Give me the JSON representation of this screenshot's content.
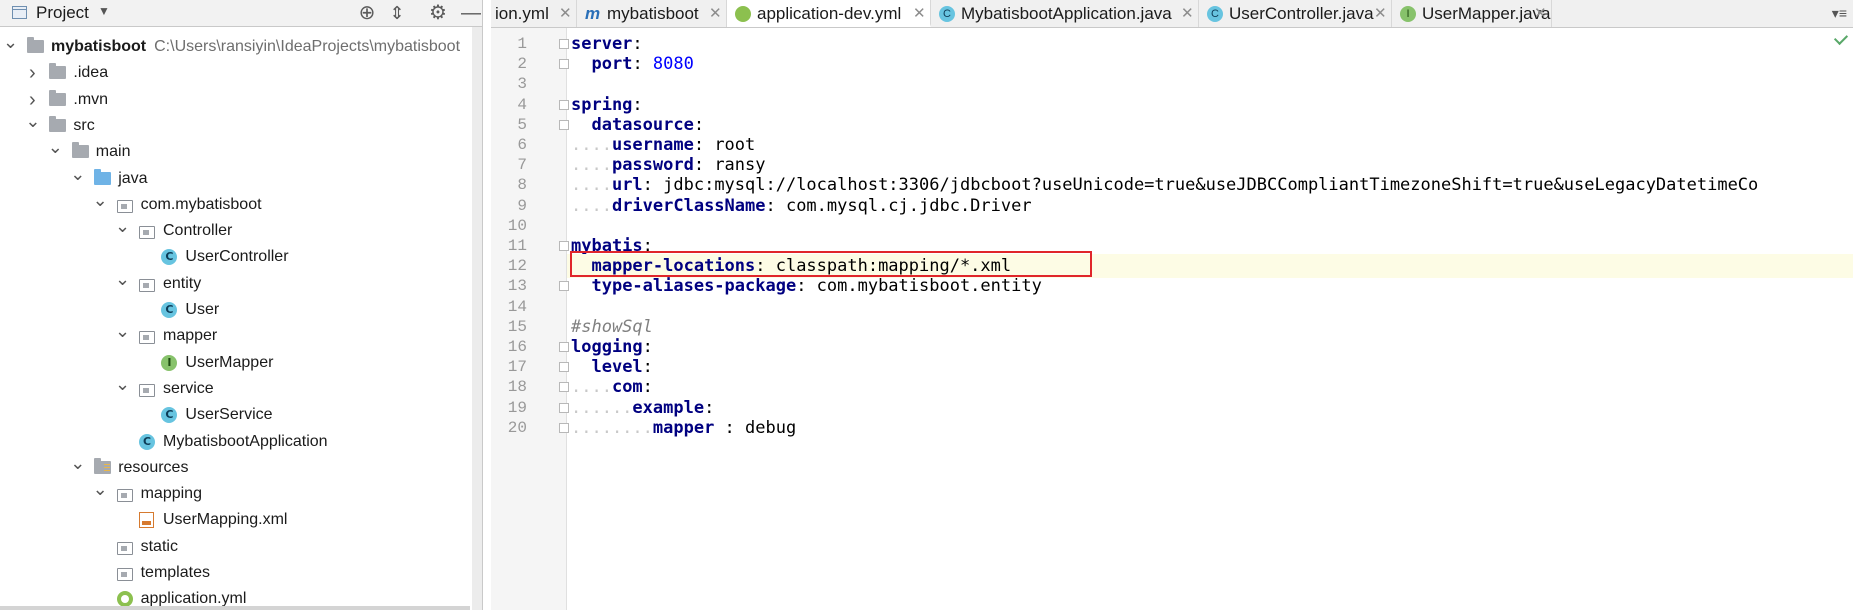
{
  "project_panel": {
    "title": "Project",
    "tree": [
      {
        "label": "mybatisboot",
        "sub": "C:\\Users\\ransiyin\\IdeaProjects\\mybatisboot",
        "depth": 0,
        "icon": "module-folder-icon",
        "expanded": true,
        "bold": true
      },
      {
        "label": ".idea",
        "depth": 1,
        "icon": "folder-icon",
        "expanded": false
      },
      {
        "label": ".mvn",
        "depth": 1,
        "icon": "folder-icon",
        "expanded": false
      },
      {
        "label": "src",
        "depth": 1,
        "icon": "folder-icon",
        "expanded": true
      },
      {
        "label": "main",
        "depth": 2,
        "icon": "folder-icon",
        "expanded": true
      },
      {
        "label": "java",
        "depth": 3,
        "icon": "source-folder-icon",
        "expanded": true
      },
      {
        "label": "com.mybatisboot",
        "depth": 4,
        "icon": "package-icon",
        "expanded": true
      },
      {
        "label": "Controller",
        "depth": 5,
        "icon": "package-icon",
        "expanded": true
      },
      {
        "label": "UserController",
        "depth": 6,
        "icon": "class-icon",
        "leaf": true
      },
      {
        "label": "entity",
        "depth": 5,
        "icon": "package-icon",
        "expanded": true
      },
      {
        "label": "User",
        "depth": 6,
        "icon": "class-icon",
        "leaf": true
      },
      {
        "label": "mapper",
        "depth": 5,
        "icon": "package-icon",
        "expanded": true
      },
      {
        "label": "UserMapper",
        "depth": 6,
        "icon": "interface-icon",
        "leaf": true
      },
      {
        "label": "service",
        "depth": 5,
        "icon": "package-icon",
        "expanded": true
      },
      {
        "label": "UserService",
        "depth": 6,
        "icon": "class-icon",
        "leaf": true
      },
      {
        "label": "MybatisbootApplication",
        "depth": 5,
        "icon": "spring-boot-class-icon",
        "leaf": true
      },
      {
        "label": "resources",
        "depth": 3,
        "icon": "resources-folder-icon",
        "expanded": true
      },
      {
        "label": "mapping",
        "depth": 4,
        "icon": "package-icon",
        "expanded": true
      },
      {
        "label": "UserMapping.xml",
        "depth": 5,
        "icon": "xml-file-icon",
        "leaf": true
      },
      {
        "label": "static",
        "depth": 4,
        "icon": "package-icon",
        "leaf": true
      },
      {
        "label": "templates",
        "depth": 4,
        "icon": "package-icon",
        "leaf": true
      },
      {
        "label": "application.yml",
        "depth": 4,
        "icon": "yml-file-icon",
        "leaf": true
      }
    ]
  },
  "tabs": [
    {
      "label": "ion.yml",
      "icon": "",
      "active": false
    },
    {
      "label": "mybatisboot",
      "icon": "m",
      "active": false
    },
    {
      "label": "application-dev.yml",
      "icon": "yml-file-icon",
      "active": true
    },
    {
      "label": "MybatisbootApplication.java",
      "icon": "spring-boot-class-icon",
      "active": false
    },
    {
      "label": "UserController.java",
      "icon": "class-icon",
      "active": false
    },
    {
      "label": "UserMapper.java",
      "icon": "interface-icon",
      "active": false
    }
  ],
  "editor": {
    "highlighted_line": 12,
    "lines": [
      {
        "n": "1",
        "tokens": [
          {
            "t": "server",
            "c": "k"
          },
          {
            "t": ":",
            "c": "v"
          }
        ]
      },
      {
        "n": "2",
        "tokens": [
          {
            "t": "  ",
            "c": "dots"
          },
          {
            "t": "port",
            "c": "k"
          },
          {
            "t": ": ",
            "c": "v"
          },
          {
            "t": "8080",
            "c": "n"
          }
        ]
      },
      {
        "n": "3",
        "tokens": []
      },
      {
        "n": "4",
        "tokens": [
          {
            "t": "spring",
            "c": "k"
          },
          {
            "t": ":",
            "c": "v"
          }
        ]
      },
      {
        "n": "5",
        "tokens": [
          {
            "t": "  ",
            "c": "dots"
          },
          {
            "t": "datasource",
            "c": "k"
          },
          {
            "t": ":",
            "c": "v"
          }
        ]
      },
      {
        "n": "6",
        "tokens": [
          {
            "t": "....",
            "c": "dots"
          },
          {
            "t": "username",
            "c": "k"
          },
          {
            "t": ": root",
            "c": "v"
          }
        ]
      },
      {
        "n": "7",
        "tokens": [
          {
            "t": "....",
            "c": "dots"
          },
          {
            "t": "password",
            "c": "k"
          },
          {
            "t": ": ransy",
            "c": "v"
          }
        ]
      },
      {
        "n": "8",
        "tokens": [
          {
            "t": "....",
            "c": "dots"
          },
          {
            "t": "url",
            "c": "k"
          },
          {
            "t": ": jdbc:mysql://localhost:3306/jdbcboot?useUnicode=true&useJDBCCompliantTimezoneShift=true&useLegacyDatetimeCo",
            "c": "v"
          }
        ]
      },
      {
        "n": "9",
        "tokens": [
          {
            "t": "....",
            "c": "dots"
          },
          {
            "t": "driverClassName",
            "c": "k"
          },
          {
            "t": ": com.mysql.cj.jdbc.Driver",
            "c": "v"
          }
        ]
      },
      {
        "n": "10",
        "tokens": []
      },
      {
        "n": "11",
        "tokens": [
          {
            "t": "mybatis",
            "c": "k"
          },
          {
            "t": ":",
            "c": "v"
          }
        ]
      },
      {
        "n": "12",
        "tokens": [
          {
            "t": "  ",
            "c": "dots"
          },
          {
            "t": "mapper-locations",
            "c": "k"
          },
          {
            "t": ": classpath:mapping/*.xml",
            "c": "v"
          }
        ]
      },
      {
        "n": "13",
        "tokens": [
          {
            "t": "  ",
            "c": "dots"
          },
          {
            "t": "type-aliases-package",
            "c": "k"
          },
          {
            "t": ": com.mybatisboot.entity",
            "c": "v"
          }
        ]
      },
      {
        "n": "14",
        "tokens": []
      },
      {
        "n": "15",
        "tokens": [
          {
            "t": "#showSql",
            "c": "c"
          }
        ]
      },
      {
        "n": "16",
        "tokens": [
          {
            "t": "logging",
            "c": "k"
          },
          {
            "t": ":",
            "c": "v"
          }
        ]
      },
      {
        "n": "17",
        "tokens": [
          {
            "t": "  ",
            "c": "dots"
          },
          {
            "t": "level",
            "c": "k"
          },
          {
            "t": ":",
            "c": "v"
          }
        ]
      },
      {
        "n": "18",
        "tokens": [
          {
            "t": "....",
            "c": "dots"
          },
          {
            "t": "com",
            "c": "k"
          },
          {
            "t": ":",
            "c": "v"
          }
        ]
      },
      {
        "n": "19",
        "tokens": [
          {
            "t": "......",
            "c": "dots"
          },
          {
            "t": "example",
            "c": "k"
          },
          {
            "t": ":",
            "c": "v"
          }
        ]
      },
      {
        "n": "20",
        "tokens": [
          {
            "t": "........",
            "c": "dots"
          },
          {
            "t": "mapper",
            "c": "k"
          },
          {
            "t": " : debug",
            "c": "v"
          }
        ]
      }
    ]
  }
}
